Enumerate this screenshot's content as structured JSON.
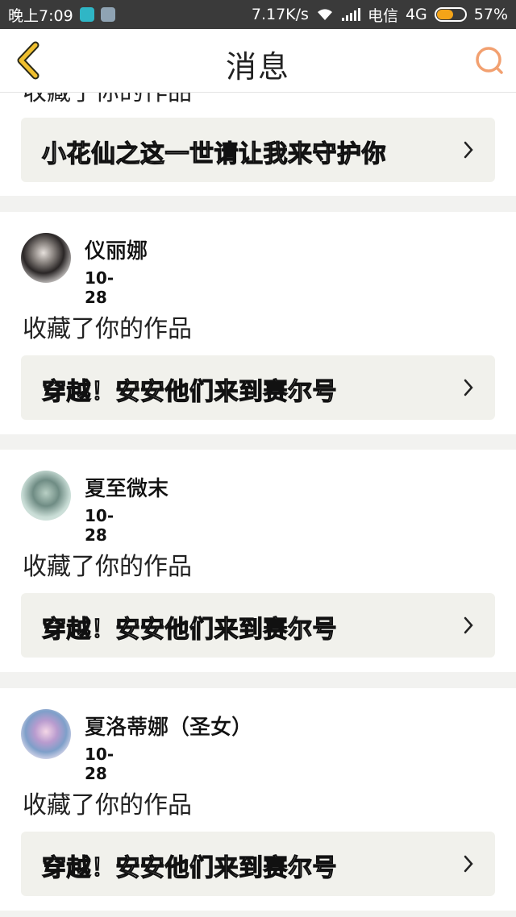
{
  "status_bar": {
    "time": "晚上7:09",
    "speed": "7.17K/s",
    "carrier": "电信",
    "network": "4G",
    "battery": "57%",
    "battery_level": 0.57
  },
  "header": {
    "title": "消息",
    "back_icon": "chevron-left-icon",
    "search_icon": "search-icon"
  },
  "messages": [
    {
      "partial": true,
      "action": "收藏了你的作品",
      "work_title": "小花仙之这一世请让我来守护你"
    },
    {
      "user": "仪丽娜",
      "date": "10-28",
      "action": "收藏了你的作品",
      "work_title": "穿越！安安他们来到赛尔号"
    },
    {
      "user": "夏至微末",
      "date": "10-28",
      "action": "收藏了你的作品",
      "work_title": "穿越！安安他们来到赛尔号"
    },
    {
      "user": "夏洛蒂娜（圣女）",
      "date": "10-28",
      "action": "收藏了你的作品",
      "work_title": "穿越！安安他们来到赛尔号"
    }
  ],
  "colors": {
    "accent": "#f0b030",
    "search": "#f2a070",
    "card_bg": "#f1f1ec",
    "divider": "#f2f2f0"
  }
}
